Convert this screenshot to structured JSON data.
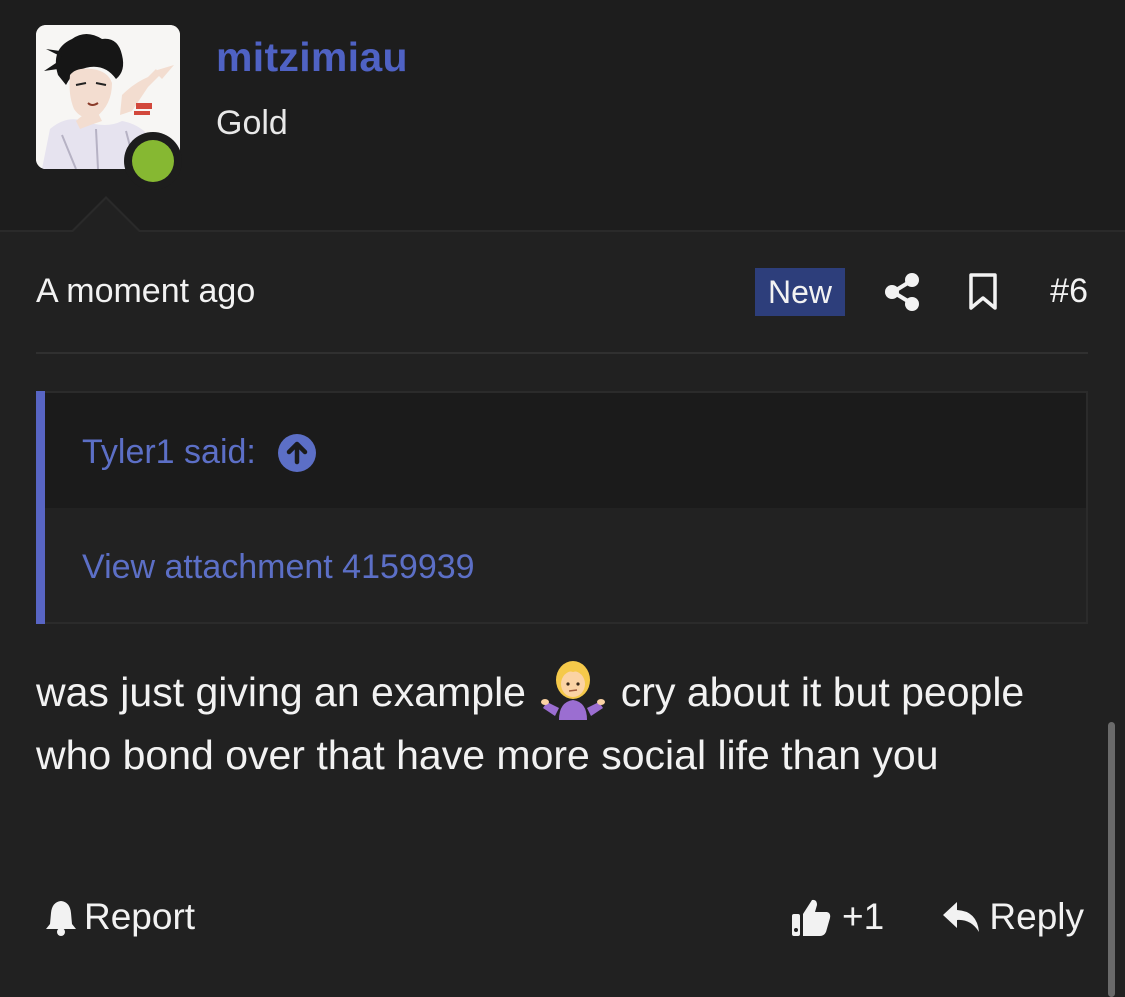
{
  "user": {
    "username": "mitzimiau",
    "title": "Gold",
    "status": "online"
  },
  "post": {
    "timestamp": "A moment ago",
    "badge": "New",
    "number": "#6",
    "icons": [
      "share-icon",
      "bookmark-icon"
    ]
  },
  "quote": {
    "author_line": "Tyler1 said:",
    "attachment": "View attachment 4159939"
  },
  "message": {
    "part1": "was just giving an example",
    "emoji": "person-shrugging-emoji",
    "part2": "cry about it but people who bond over that have more social life than you"
  },
  "actions": {
    "report_label": "Report",
    "like_count": "+1",
    "reply_label": "Reply"
  },
  "colors": {
    "background": "#212121",
    "username": "#4f62c4",
    "link": "#5c6fc6",
    "badge": "#2d3e7b",
    "online": "#86b832"
  }
}
